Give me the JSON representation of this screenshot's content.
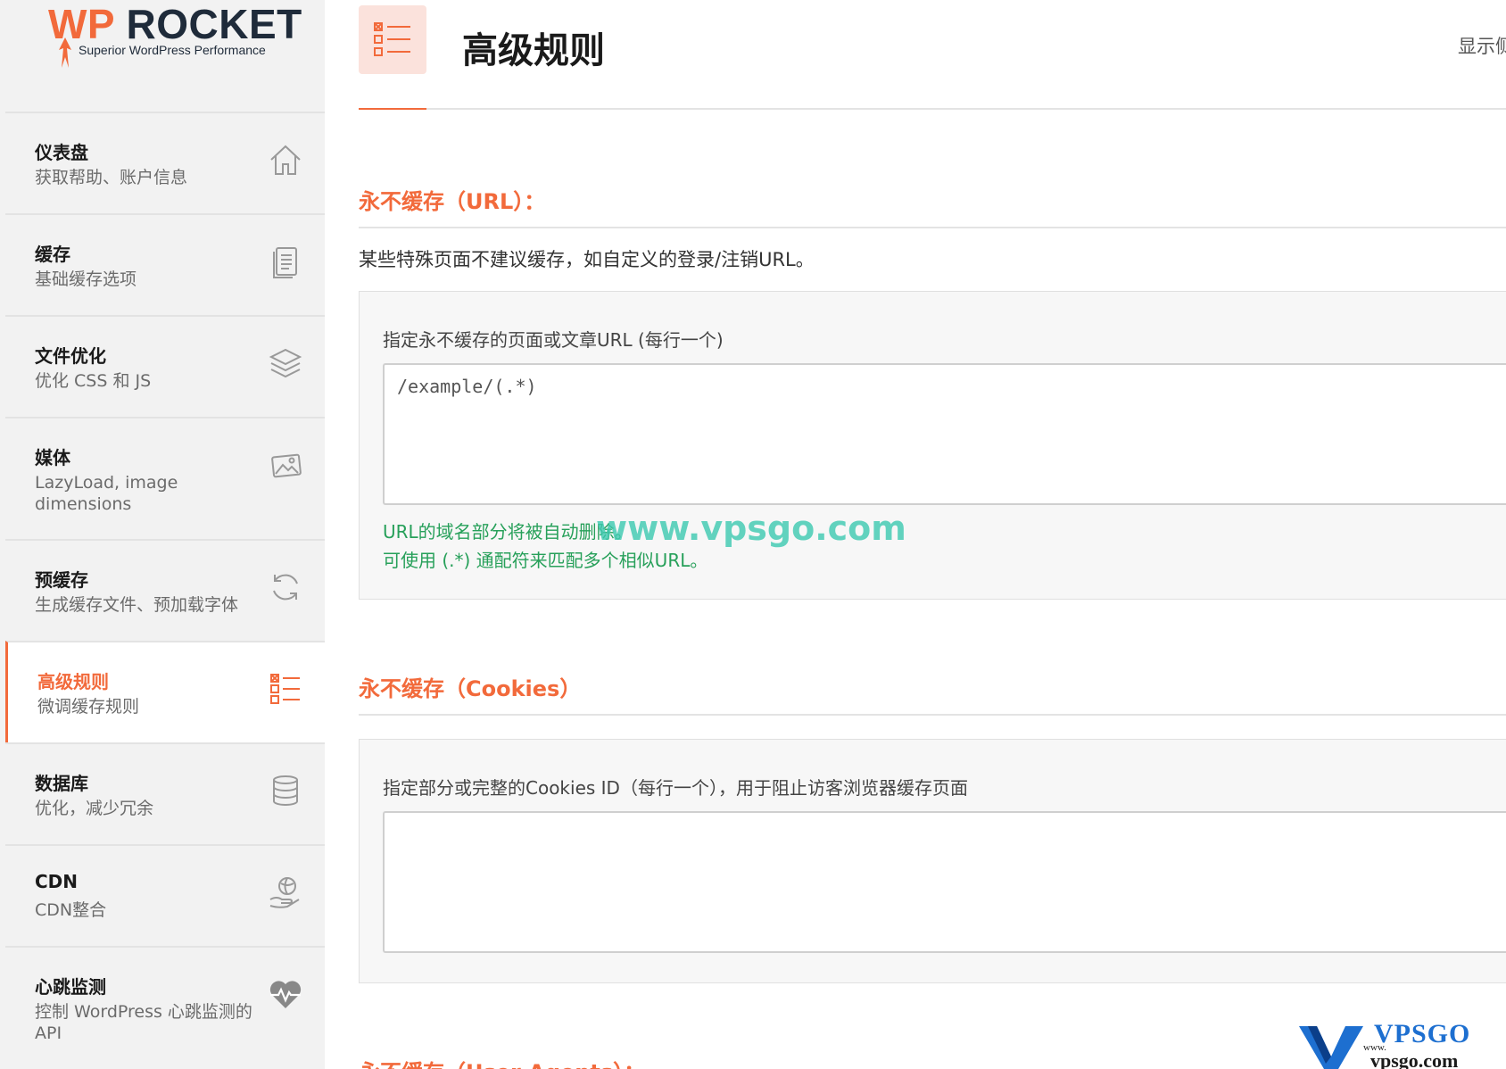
{
  "brand": {
    "logo_wp": "WP",
    "logo_rocket": " ROCKET",
    "tagline": "Superior WordPress Performance",
    "accent_color": "#f26a3b",
    "success_color": "#27a05a"
  },
  "sidebar": {
    "items": [
      {
        "title": "仪表盘",
        "desc": "获取帮助、账户信息",
        "icon": "home-icon"
      },
      {
        "title": "缓存",
        "desc": "基础缓存选项",
        "icon": "document-icon"
      },
      {
        "title": "文件优化",
        "desc": "优化 CSS 和 JS",
        "icon": "layers-icon"
      },
      {
        "title": "媒体",
        "desc": "LazyLoad, image dimensions",
        "icon": "image-icon"
      },
      {
        "title": "预缓存",
        "desc": "生成缓存文件、预加载字体",
        "icon": "refresh-icon"
      },
      {
        "title": "高级规则",
        "desc": "微调缓存规则",
        "icon": "checklist-icon",
        "active": true
      },
      {
        "title": "数据库",
        "desc": "优化，减少冗余",
        "icon": "database-icon"
      },
      {
        "title": "CDN",
        "desc": "CDN整合",
        "icon": "globe-hand-icon"
      },
      {
        "title": "心跳监测",
        "desc": "控制 WordPress 心跳监测的 API",
        "icon": "heartbeat-icon"
      }
    ]
  },
  "header": {
    "title": "高级规则",
    "display_link": "显示侧"
  },
  "sections": {
    "url": {
      "title": "永不缓存（URL）：",
      "desc": "某些特殊页面不建议缓存，如自定义的登录/注销URL。",
      "field_label": "指定永不缓存的页面或文章URL (每行一个)",
      "placeholder": "/example/(.*)",
      "help_1": "URL的域名部分将被自动删除。",
      "help_2": "可使用 (.*) 通配符来匹配多个相似URL。"
    },
    "cookies": {
      "title": "永不缓存（Cookies）",
      "field_label": "指定部分或完整的Cookies ID（每行一个），用于阻止访客浏览器缓存页面",
      "placeholder": ""
    },
    "user_agents": {
      "title": "永不缓存（User Agents）："
    }
  },
  "watermark": {
    "text": "www.vpsgo.com",
    "corner_brand": "VPSGO",
    "corner_www": "www.",
    "corner_domain": "vpsgo.com"
  }
}
